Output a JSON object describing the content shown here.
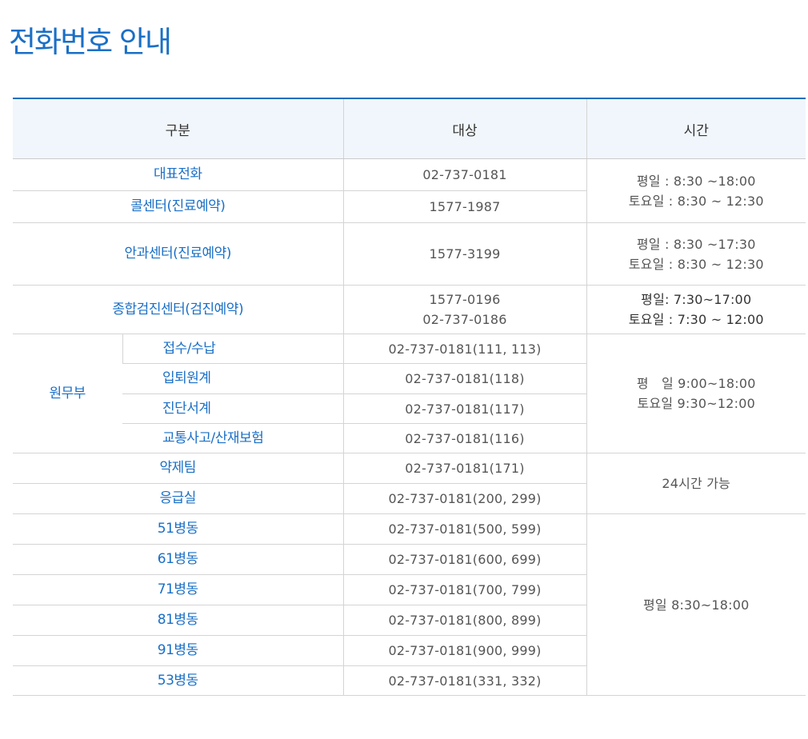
{
  "page": {
    "title": "전화번호 안내"
  },
  "table": {
    "headers": [
      "구분",
      "대상",
      "시간"
    ],
    "rows": [
      {
        "dept": "대표전화",
        "number": "02-737-0181",
        "hours": [
          "평일 : 8:30 ~18:00",
          "토요일 : 8:30 ~ 12:30"
        ]
      },
      {
        "dept": "콜센터(진료예약)",
        "number": "1577-1987"
      },
      {
        "dept": "안과센터(진료예약)",
        "number": "1577-3199",
        "hours": [
          "평일 : 8:30 ~17:30",
          "토요일 : 8:30 ~ 12:30"
        ]
      },
      {
        "dept": "종합검진센터(검진예약)",
        "numbers": [
          "1577-0196",
          "02-737-0186"
        ],
        "hours": [
          "평일: 7:30~17:00",
          "토요일 : 7:30 ~ 12:00"
        ]
      },
      {
        "group": "원무부",
        "dept": "접수/수납",
        "number": "02-737-0181(111, 113)",
        "hours": [
          "평　일 9:00~18:00",
          "토요일 9:30~12:00"
        ]
      },
      {
        "dept": "입퇴원계",
        "number": "02-737-0181(118)"
      },
      {
        "dept": "진단서계",
        "number": "02-737-0181(117)"
      },
      {
        "dept": "교통사고/산재보험",
        "number": "02-737-0181(116)"
      },
      {
        "dept": "약제팀",
        "number": "02-737-0181(171)",
        "hours": [
          "24시간 가능"
        ]
      },
      {
        "dept": "응급실",
        "number": "02-737-0181(200, 299)"
      },
      {
        "dept": "51병동",
        "number": "02-737-0181(500, 599)",
        "hours": [
          "평일 8:30~18:00"
        ]
      },
      {
        "dept": "61병동",
        "number": "02-737-0181(600, 699)"
      },
      {
        "dept": "71병동",
        "number": "02-737-0181(700, 799)"
      },
      {
        "dept": "81병동",
        "number": "02-737-0181(800, 899)"
      },
      {
        "dept": "91병동",
        "number": "02-737-0181(900, 999)"
      },
      {
        "dept": "53병동",
        "number": "02-737-0181(331, 332)"
      }
    ]
  }
}
